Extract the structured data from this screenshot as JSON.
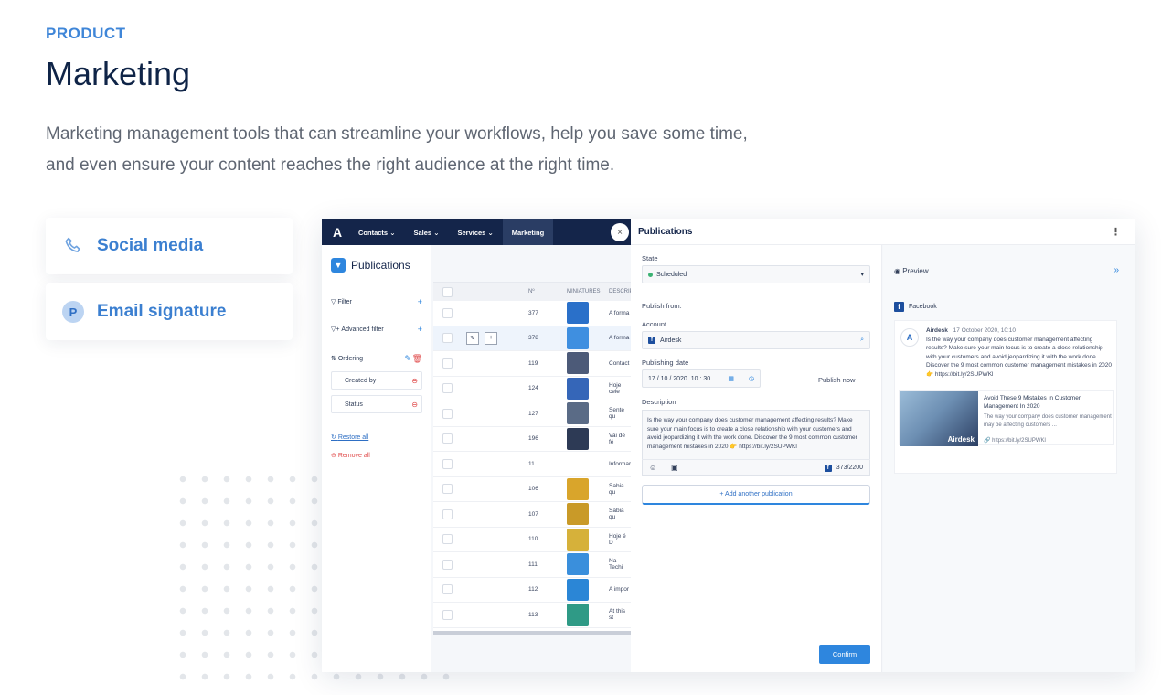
{
  "header": {
    "eyebrow": "PRODUCT",
    "title": "Marketing",
    "desc_line1": "Marketing management tools that can streamline your workflows, help you save some time,",
    "desc_line2": "and even ensure your content reaches the right audience at the right time."
  },
  "features": [
    {
      "label": "Social media",
      "icon": "phone-icon"
    },
    {
      "label": "Email signature",
      "icon": "p-badge-icon",
      "badge": "P"
    }
  ],
  "app": {
    "nav": [
      "Contacts",
      "Sales",
      "Services",
      "Marketing"
    ],
    "logo": "A",
    "close": "×",
    "left": {
      "title": "Publications",
      "filter": "Filter",
      "advanced_filter": "Advanced filter",
      "ordering": "Ordering",
      "created_by": "Created by",
      "status": "Status",
      "restore_all": "Restore all",
      "remove_all": "Remove all"
    },
    "table": {
      "headers": [
        "Nº",
        "MINIATURES",
        "DESCRIP"
      ],
      "rows": [
        {
          "num": "377",
          "text": "A forma"
        },
        {
          "num": "378",
          "text": "A forma"
        },
        {
          "num": "119",
          "text": "Contact"
        },
        {
          "num": "124",
          "text": "Hoje cele"
        },
        {
          "num": "127",
          "text": "Sente qu"
        },
        {
          "num": "196",
          "text": "Vai de fé"
        },
        {
          "num": "11",
          "text": "Informar"
        },
        {
          "num": "106",
          "text": "Sabia qu"
        },
        {
          "num": "107",
          "text": "Sabia qu"
        },
        {
          "num": "110",
          "text": "Hoje é D"
        },
        {
          "num": "111",
          "text": "Na Techi"
        },
        {
          "num": "112",
          "text": "A impor"
        },
        {
          "num": "113",
          "text": "At this st"
        }
      ]
    },
    "form": {
      "title": "Publications",
      "state_label": "State",
      "state_value": "Scheduled",
      "publish_from": "Publish from:",
      "account_label": "Account",
      "account_value": "Airdesk",
      "date_label": "Publishing date",
      "date_value": "17 / 10 / 2020",
      "time_value": "10 : 30",
      "publish_now": "Publish now",
      "description_label": "Description",
      "description": "Is the way your company does customer management affecting results? Make sure your main focus is to create a close relationship with your customers and avoid jeopardizing it with the work done. Discover the 9 most common customer management mistakes in 2020 👉 https://bit.ly/2SUPWKl",
      "char_count": "373/2200",
      "add_publication": "+ Add another publication",
      "confirm": "Confirm"
    },
    "preview": {
      "title": "Preview",
      "network": "Facebook",
      "author": "Airdesk",
      "date": "17 October 2020, 10:10",
      "text": "Is the way your company does customer management affecting results? Make sure your main focus is to create a close relationship with your customers and avoid jeopardizing it with the work done. Discover the 9 most common customer management mistakes in 2020 👉 https://bit.ly/2SUPWKl",
      "link_title": "Avoid These 9 Mistakes In Customer Management In 2020",
      "link_desc": "The way your company does customer management may be affecting customers ...",
      "link_url": "https://bit.ly/2SUPWKl",
      "image_brand": "Airdesk"
    }
  }
}
